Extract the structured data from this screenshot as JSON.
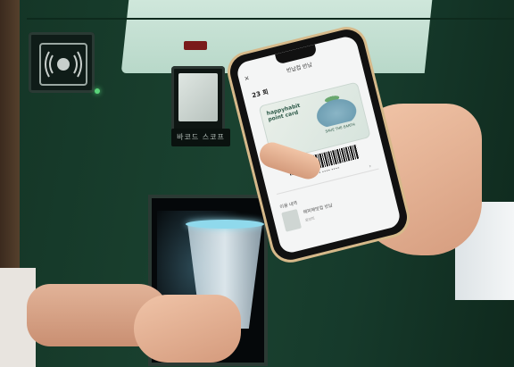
{
  "scene": {
    "description_free": true
  },
  "machine": {
    "nfc_icon": "nfc-contactless-icon",
    "scanner_label": "바코드 스코프",
    "colors": {
      "body": "#1a4230",
      "window": "#cfe7db",
      "led": "#59d47a",
      "cup_rim": "#8fd9ec"
    }
  },
  "phone": {
    "back_icon": "close-icon",
    "title": "반납컵 반납",
    "count": "23 회",
    "card": {
      "brand": "happyhabit point card",
      "tagline": "SAVE THE EARTH"
    },
    "barcode_number": "•••• •••• ••••",
    "arrow": "›",
    "section": "이용 내역",
    "item": "해피해빗컵 반납",
    "item_sub": "포인트"
  }
}
